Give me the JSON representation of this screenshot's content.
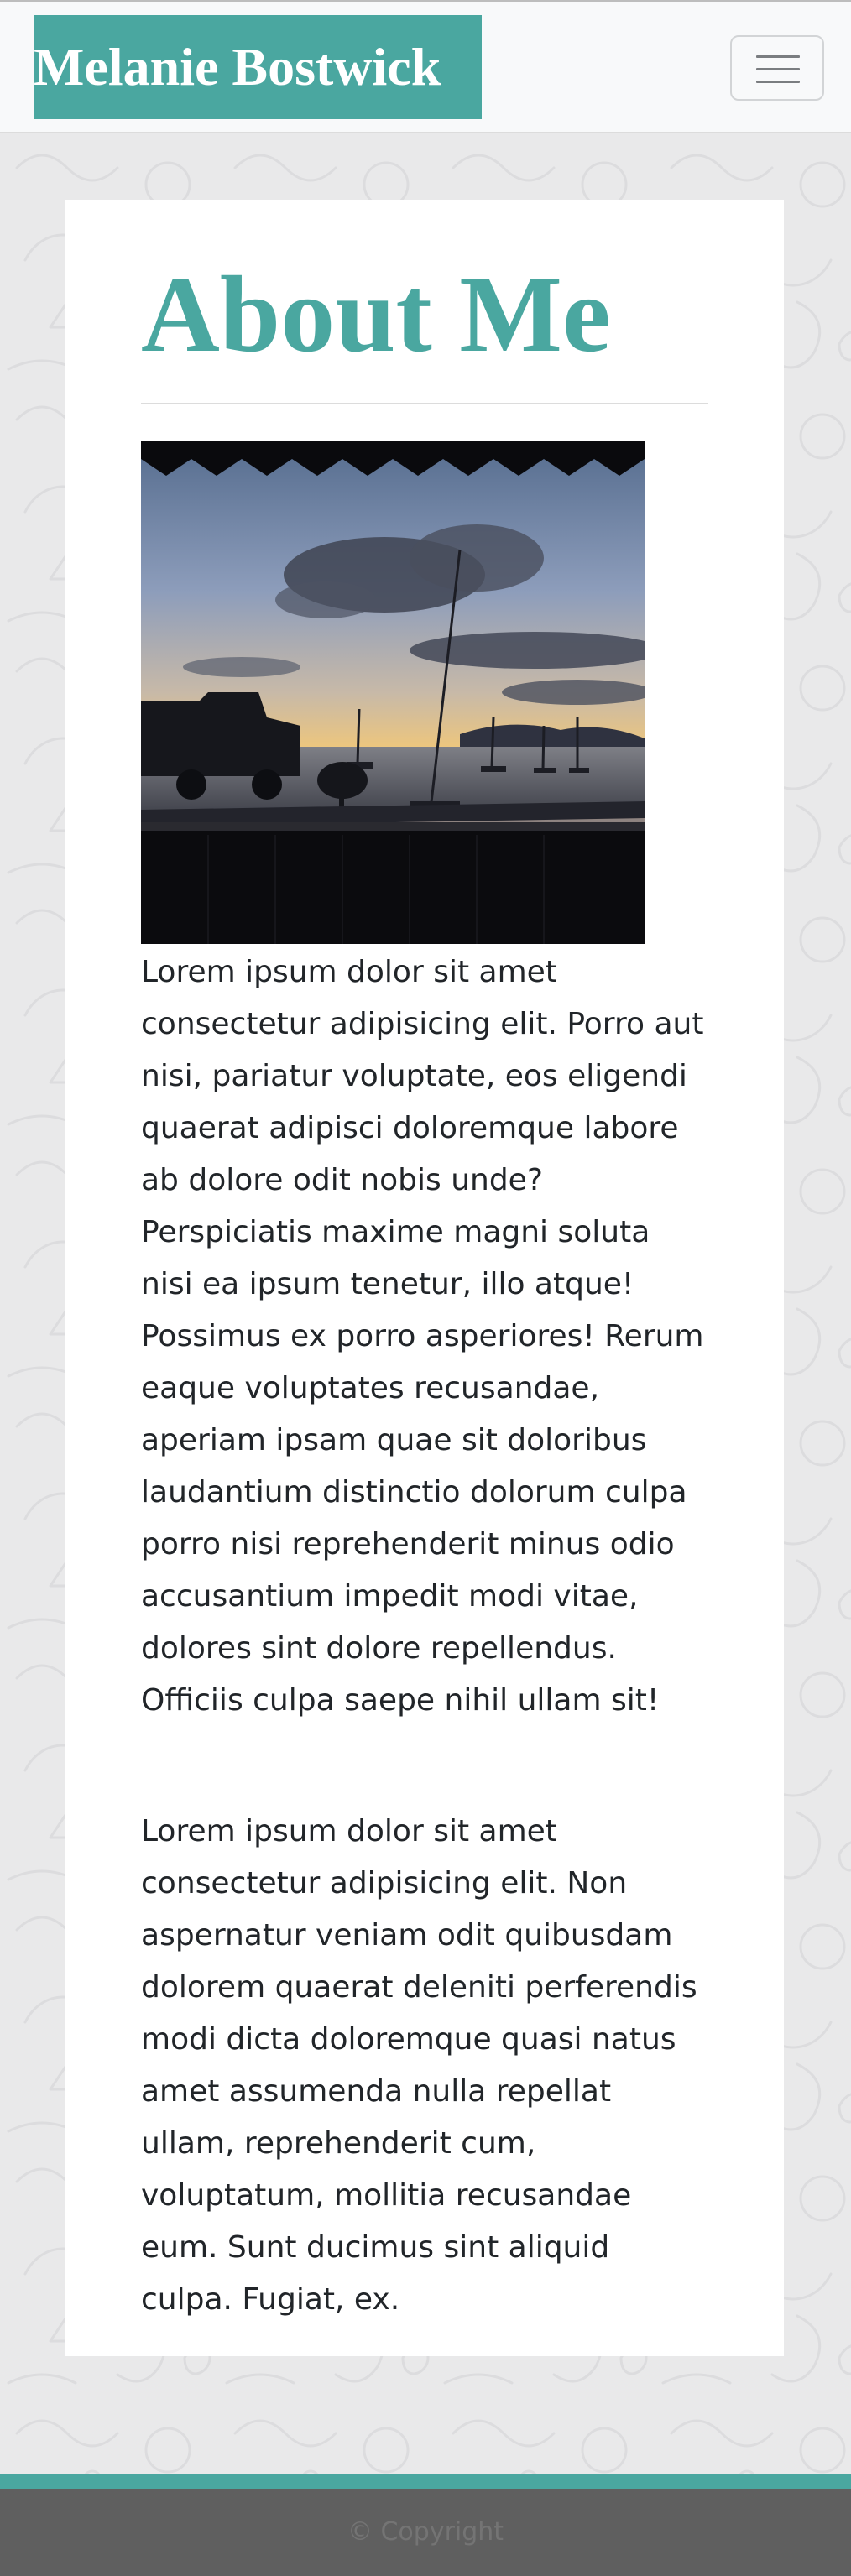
{
  "navbar": {
    "brand": "Melanie Bostwick",
    "toggle_icon": "hamburger-menu-icon"
  },
  "main": {
    "heading": "About Me",
    "photo": {
      "icon": "sunset-harbor-photo"
    },
    "paragraphs": [
      "Lorem ipsum dolor sit amet consectetur adipisicing elit. Porro aut nisi, pariatur voluptate, eos eligendi quaerat adipisci doloremque labore ab dolore odit nobis unde? Perspiciatis maxime magni soluta nisi ea ipsum tenetur, illo atque! Possimus ex porro asperiores! Rerum eaque voluptates recusandae, aperiam ipsam quae sit doloribus laudantium distinctio dolorum culpa porro nisi reprehenderit minus odio accusantium impedit modi vitae, dolores sint dolore repellendus. Officiis culpa saepe nihil ullam sit!",
      "Lorem ipsum dolor sit amet consectetur adipisicing elit. Non aspernatur veniam odit quibusdam dolorem quaerat deleniti perferendis modi dicta doloremque quasi natus amet assumenda nulla repellat ullam, reprehenderit cum, voluptatum, mollitia recusandae eum. Sunt ducimus sint aliquid culpa. Fugiat, ex."
    ]
  },
  "footer": {
    "copyright": "© Copyright"
  },
  "colors": {
    "accent": "#4aa7a0",
    "page_background": "#e9e9ea",
    "footer_background": "#5f5f5f",
    "text": "#212529"
  }
}
